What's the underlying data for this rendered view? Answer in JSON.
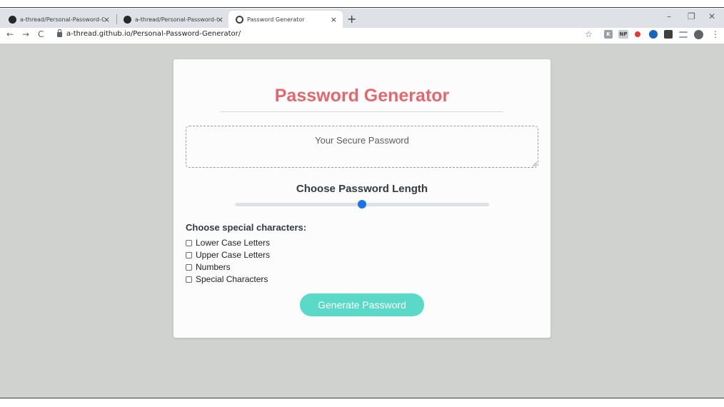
{
  "browser": {
    "tabs": [
      {
        "title": "a-thread/Personal-Password-Gen",
        "icon": "github-icon",
        "close": "×"
      },
      {
        "title": "a-thread/Personal-Password-Gen",
        "icon": "github-icon",
        "close": "×"
      },
      {
        "title": "Password Generator",
        "icon": "globe-icon",
        "close": "×",
        "active": true
      }
    ],
    "new_tab": "+",
    "window_controls": {
      "minimize": "–",
      "maximize": "❐",
      "close": "✕"
    },
    "nav": {
      "back": "←",
      "forward": "→",
      "reload": "C"
    },
    "url": "a-thread.github.io/Personal-Password-Generator/",
    "star": "☆",
    "extensions": [
      {
        "label": "K",
        "color": "#9aa0a6"
      },
      {
        "label": "NP",
        "color": "#c9cdd1"
      },
      {
        "label": "",
        "color": "#e53935"
      },
      {
        "label": "",
        "color": "#1565c0"
      },
      {
        "label": "",
        "color": "#3c4043"
      },
      {
        "label": "",
        "color": "#9aa0a6"
      }
    ],
    "menu": "⋮"
  },
  "page": {
    "title": "Password Generator",
    "password_placeholder": "Your Secure Password",
    "length_label": "Choose Password Length",
    "slider_value_fraction": 0.5,
    "special_label": "Choose special characters:",
    "options": [
      {
        "label": "Lower Case Letters",
        "checked": false
      },
      {
        "label": "Upper Case Letters",
        "checked": false
      },
      {
        "label": "Numbers",
        "checked": false
      },
      {
        "label": "Special Characters",
        "checked": false
      }
    ],
    "generate_button": "Generate Password"
  },
  "colors": {
    "accent_title": "#e2686e",
    "button": "#5ad9c9",
    "slider_thumb": "#1a73e8",
    "background": "#d0d2d0"
  }
}
